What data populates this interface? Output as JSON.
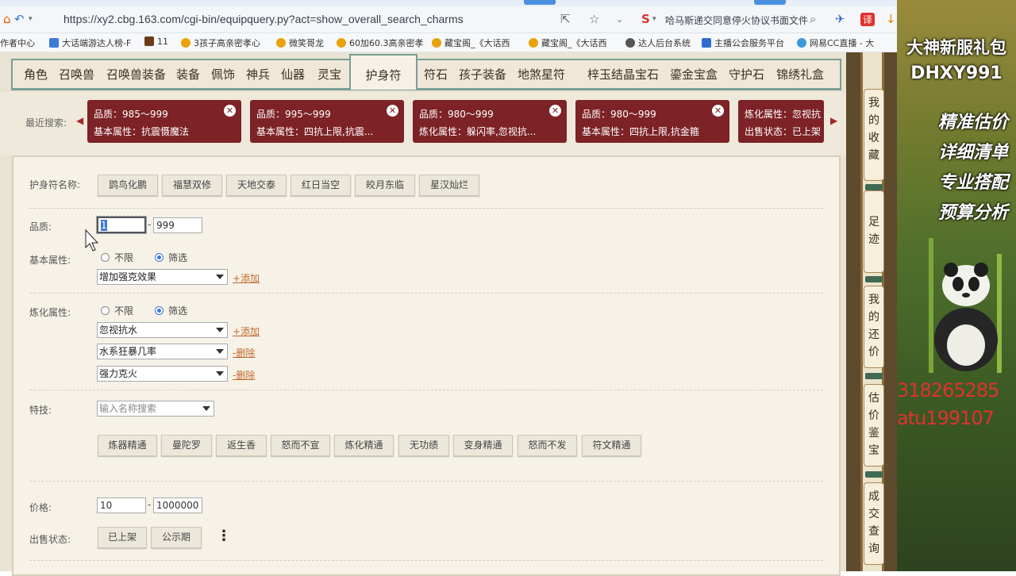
{
  "browser": {
    "url": "https://xy2.cbg.163.com/cgi-bin/equipquery.py?act=show_overall_search_charms",
    "tab_hint": "哈马斯递交同意停火协议书面文件",
    "bookmarks": [
      "作者中心",
      "大话端游达人榜-F",
      "11",
      "3孩子高亲密孝心",
      "微笑哥龙",
      "60加60.3高亲密孝",
      "藏宝阁_《大话西",
      "藏宝阁_《大话西",
      "达人后台系统",
      "主播公会服务平台",
      "网易CC直播 - 大"
    ]
  },
  "nav": {
    "tabs": [
      "角色",
      "召唤兽",
      "召唤兽装备",
      "装备",
      "佩饰",
      "神兵",
      "仙器",
      "灵宝",
      "护身符",
      "符石",
      "孩子装备",
      "地煞星符",
      "梓玉结晶",
      "宝石",
      "鎏金宝盒",
      "守护石",
      "锦绣礼盒"
    ],
    "active": "护身符"
  },
  "recent": {
    "label": "最近搜索:",
    "cards": [
      {
        "line1": "品质：985～999",
        "line2": "基本属性：抗震慑魔法"
      },
      {
        "line1": "品质：995～999",
        "line2": "基本属性：四抗上限,抗震..."
      },
      {
        "line1": "品质：980～999",
        "line2": "炼化属性：躲闪率,忽视抗..."
      },
      {
        "line1": "品质：980～999",
        "line2": "基本属性：四抗上限,抗金箍"
      },
      {
        "line1": "炼化属性：忽视抗",
        "line2": "出售状态：已上架"
      }
    ]
  },
  "form": {
    "name_label": "护身符名称:",
    "names": [
      "鹍鸟化鹏",
      "福慧双修",
      "天地交泰",
      "红日当空",
      "皎月东临",
      "星汉灿烂"
    ],
    "quality_label": "品质:",
    "quality_min": "1",
    "quality_max": "999",
    "base_label": "基本属性:",
    "radio_none": "不限",
    "radio_filter": "筛选",
    "base_select": "增加强克效果",
    "add_link": "+添加",
    "refine_label": "炼化属性:",
    "refine_selects": [
      "忽视抗水",
      "水系狂暴几率",
      "强力克火"
    ],
    "del_link": "-删除",
    "skill_label": "特技:",
    "skill_placeholder": "输入名称搜索",
    "skills": [
      "炼器精通",
      "曼陀罗",
      "返生香",
      "怒而不宣",
      "炼化精通",
      "无功绩",
      "变身精通",
      "怒而不发",
      "符文精通"
    ],
    "price_label": "价格:",
    "price_min": "10",
    "price_max": "1000000",
    "status_label": "出售状态:",
    "status_options": [
      "已上架",
      "公示期"
    ],
    "range_sep": "-"
  },
  "sidebar": {
    "items": [
      "我的收藏",
      "足迹",
      "我的还价",
      "估价鉴宝",
      "成交查询"
    ]
  },
  "ad": {
    "title": "大神新服礼包",
    "code": "DHXY991",
    "lines": [
      "精准估价",
      "详细清单",
      "专业搭配",
      "预算分析"
    ],
    "num1": "318265285",
    "num2": "atu199107"
  }
}
